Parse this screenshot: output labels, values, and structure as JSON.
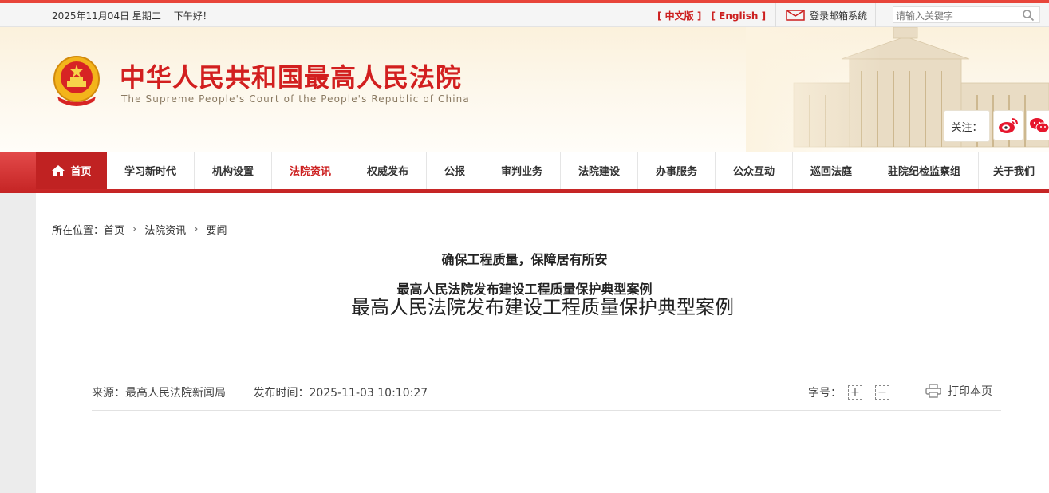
{
  "topbar": {
    "date": "2025年11月04日 星期二",
    "greeting": "下午好！",
    "lang_cn": "[ 中文版 ]",
    "lang_en": "[ English ]",
    "mail_label": "登录邮箱系统",
    "search_placeholder": "请输入关键字"
  },
  "header": {
    "title": "中华人民共和国最高人民法院",
    "subtitle": "The Supreme People's Court of the People's Republic of China",
    "follow_label": "关注："
  },
  "nav": {
    "home": "首页",
    "items": [
      "学习新时代",
      "机构设置",
      "法院资讯",
      "权威发布",
      "公报",
      "审判业务",
      "法院建设",
      "办事服务",
      "公众互动",
      "巡回法庭",
      "驻院纪检监察组",
      "关于我们"
    ],
    "active": "法院资讯"
  },
  "breadcrumb": {
    "prefix": "所在位置：",
    "items": [
      "首页",
      "法院资讯",
      "要闻"
    ]
  },
  "article": {
    "title": "最高人民法院发布建设工程质量保护典型案例",
    "source": "来源：最高人民法院新闻局",
    "published": "发布时间：2025-11-03 10:10:27",
    "font_size_label": "字号：",
    "font_increase": "+",
    "font_decrease": "−",
    "print_label": "打印本页",
    "subheading_1": "确保工程质量，保障居有所安",
    "subheading_2": "最高人民法院发布建设工程质量保护典型案例"
  },
  "colors": {
    "brand_red": "#d21f1f",
    "nav_red": "#c52424"
  },
  "icons": [
    "mail-icon",
    "search-icon",
    "emblem",
    "weibo-icon",
    "wechat-icon",
    "home-icon",
    "printer-icon"
  ]
}
